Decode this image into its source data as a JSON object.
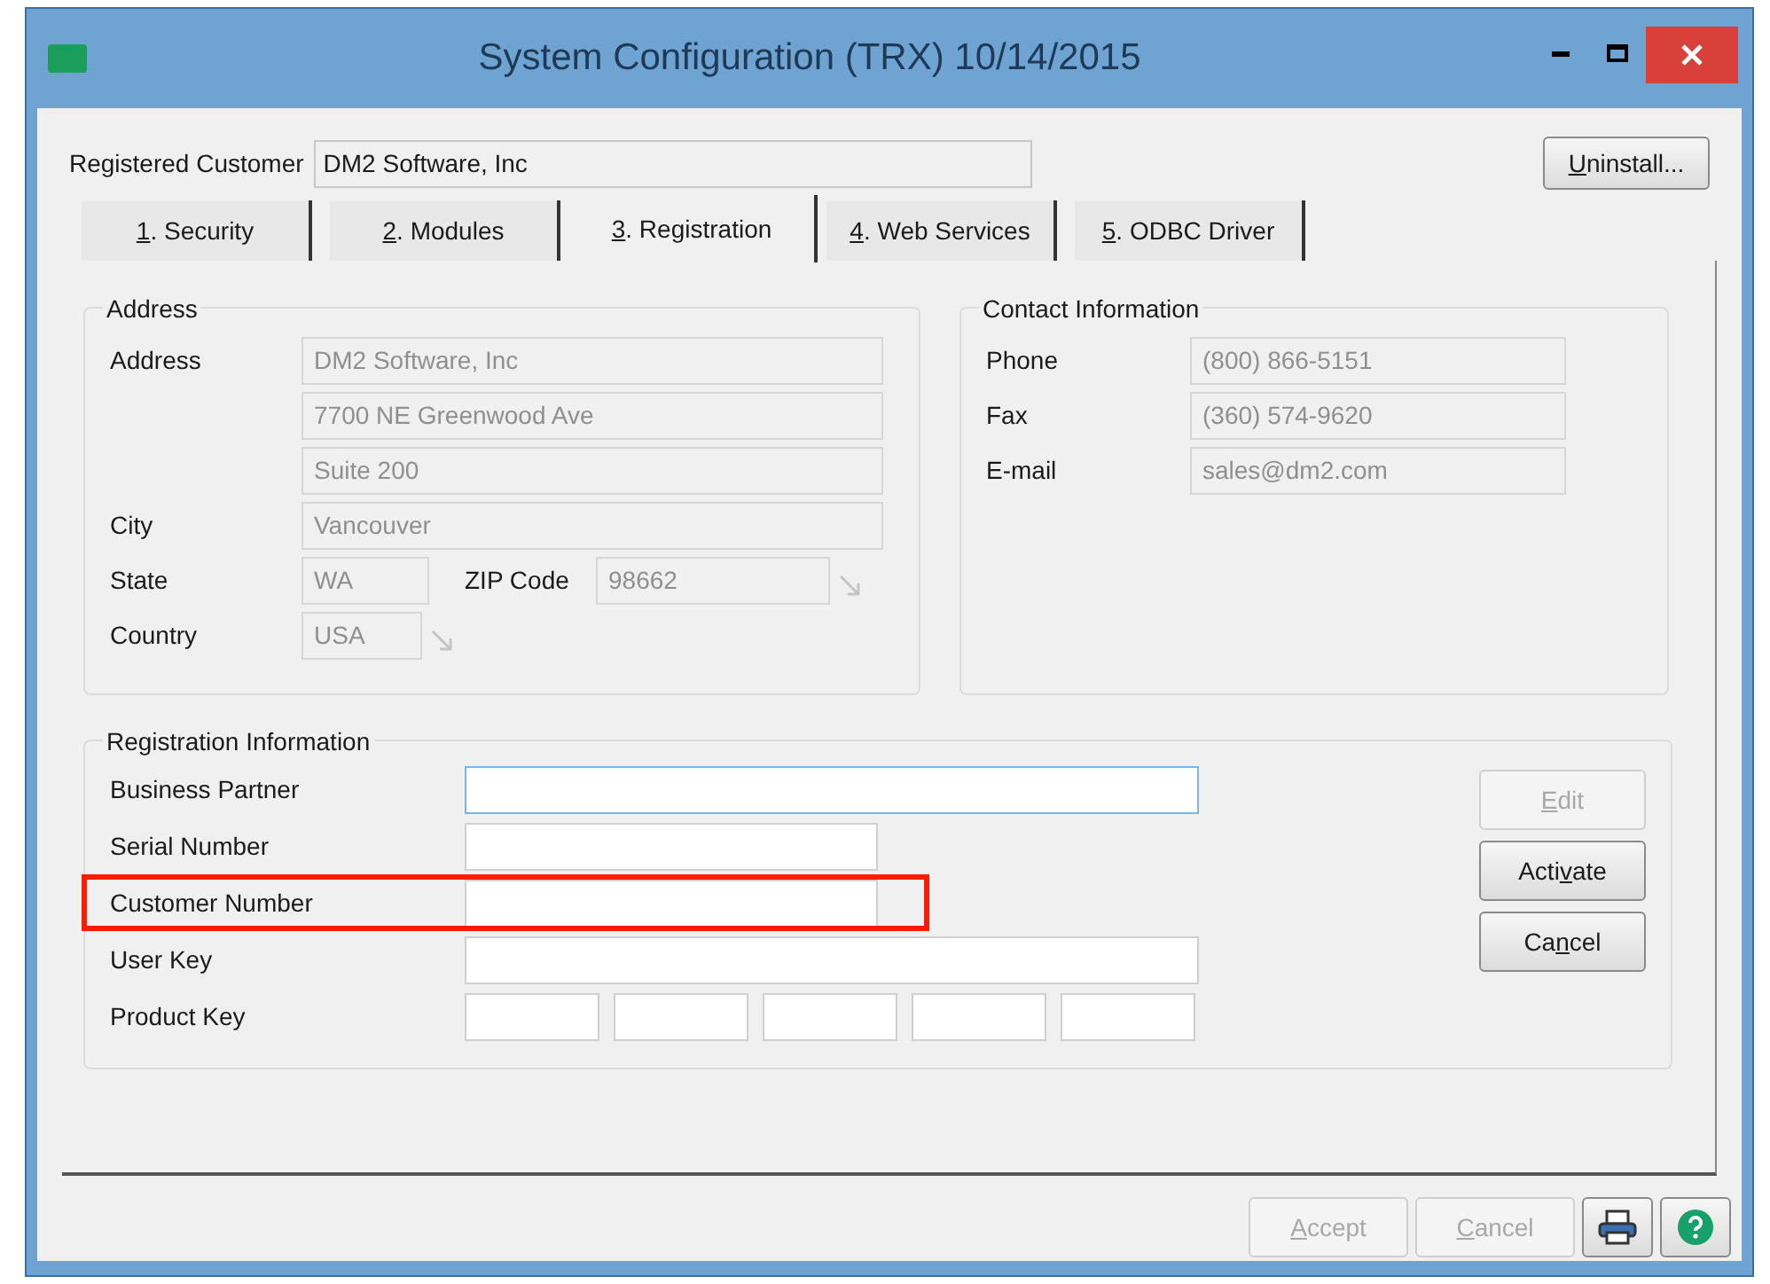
{
  "window": {
    "title": "System Configuration (TRX) 10/14/2015"
  },
  "registered_customer": {
    "label": "Registered Customer",
    "value": "DM2 Software, Inc"
  },
  "uninstall_button": {
    "key": "U",
    "post": "ninstall...",
    "disabled": false
  },
  "tabs": [
    {
      "key": "1",
      "post": ". Security",
      "selected": false
    },
    {
      "key": "2",
      "post": ". Modules",
      "selected": false
    },
    {
      "key": "3",
      "post": ". Registration",
      "selected": true
    },
    {
      "key": "4",
      "post": ". Web Services",
      "selected": false
    },
    {
      "key": "5",
      "post": ". ODBC Driver",
      "selected": false
    }
  ],
  "address": {
    "title": "Address",
    "rows": [
      {
        "label": "Address",
        "value": "DM2 Software, Inc"
      },
      {
        "label": "",
        "value": "7700 NE Greenwood Ave"
      },
      {
        "label": "",
        "value": "Suite 200"
      },
      {
        "label": "City",
        "value": "Vancouver"
      }
    ],
    "state": {
      "label": "State",
      "value": "WA"
    },
    "zip": {
      "label": "ZIP Code",
      "value": "98662"
    },
    "country": {
      "label": "Country",
      "value": "USA"
    }
  },
  "contact": {
    "title": "Contact Information",
    "rows": [
      {
        "label": "Phone",
        "value": "(800) 866-5151"
      },
      {
        "label": "Fax",
        "value": "(360) 574-9620"
      },
      {
        "label": "E-mail",
        "value": "sales@dm2.com"
      }
    ]
  },
  "registration": {
    "title": "Registration Information",
    "rows": [
      {
        "label": "Business Partner",
        "kind": "wide",
        "focused": true,
        "highlighted": false
      },
      {
        "label": "Serial Number",
        "kind": "short",
        "focused": false,
        "highlighted": false
      },
      {
        "label": "Customer Number",
        "kind": "short",
        "focused": false,
        "highlighted": true
      },
      {
        "label": "User Key",
        "kind": "wide",
        "focused": false,
        "highlighted": false
      },
      {
        "label": "Product Key",
        "kind": "segments",
        "focused": false,
        "highlighted": false
      }
    ],
    "buttons": [
      {
        "key": "E",
        "post": "dit",
        "disabled": true
      },
      {
        "pre": "Acti",
        "key": "v",
        "post": "ate",
        "disabled": false
      },
      {
        "pre": "Ca",
        "key": "n",
        "post": "cel",
        "disabled": false
      }
    ]
  },
  "footer_buttons": [
    {
      "key": "A",
      "post": "ccept",
      "disabled": true
    },
    {
      "key": "C",
      "post": "ancel",
      "disabled": true
    }
  ]
}
